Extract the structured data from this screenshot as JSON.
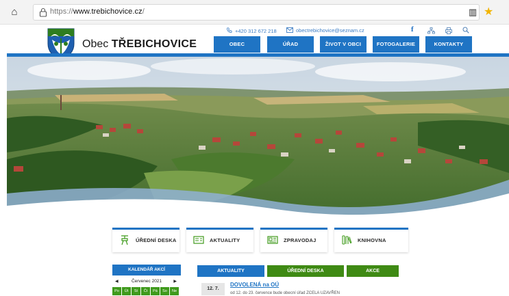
{
  "browser": {
    "url": "https://www.trebichovice.cz/",
    "url_host": "www.trebichovice.cz",
    "url_scheme": "https://",
    "url_tail": "/"
  },
  "header": {
    "phone": "+420 312 672 218",
    "email": "obectrebichovice@seznam.cz",
    "title_prefix": "Obec",
    "title_name": "TŘEBICHOVICE",
    "social": [
      "facebook-icon",
      "sitemap-icon",
      "print-icon",
      "search-icon"
    ]
  },
  "nav": {
    "items": [
      {
        "label": "OBEC"
      },
      {
        "label": "ÚŘAD"
      },
      {
        "label": "ŽIVOT V OBCI"
      },
      {
        "label": "FOTOGALERIE"
      },
      {
        "label": "KONTAKTY"
      }
    ]
  },
  "quick_links": [
    {
      "label": "ÚŘEDNÍ DESKA",
      "icon": "board-icon"
    },
    {
      "label": "AKTUALITY",
      "icon": "news-icon"
    },
    {
      "label": "ZPRAVODAJ",
      "icon": "newspaper-icon"
    },
    {
      "label": "KNIHOVNA",
      "icon": "library-icon"
    }
  ],
  "calendar": {
    "title": "KALENDÁŘ AKCÍ",
    "month": "Červenec 2021",
    "prev": "◀",
    "next": "▶",
    "weekdays": [
      "Po",
      "Út",
      "St",
      "Čt",
      "Pá",
      "So",
      "Ne"
    ]
  },
  "tabs": [
    {
      "label": "AKTUALITY"
    },
    {
      "label": "ÚŘEDNÍ DESKA"
    },
    {
      "label": "AKCE"
    }
  ],
  "news": {
    "date": "12. 7.",
    "title": "DOVOLENÁ na OÚ",
    "text": "od 12. do 23. července bude obecní úřad ZCELA UZAVŘEN"
  },
  "colors": {
    "brand_blue": "#1f74c4",
    "green": "#3f9a1c",
    "star": "#f2b400"
  }
}
